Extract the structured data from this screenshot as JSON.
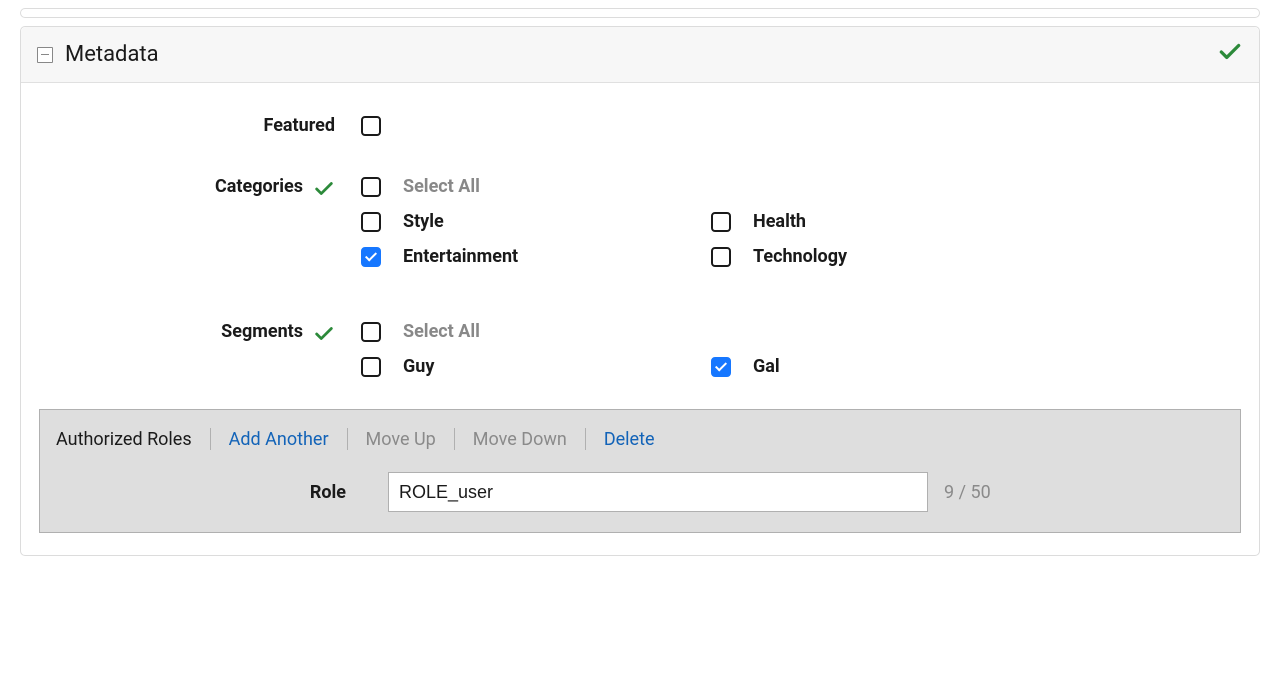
{
  "panel": {
    "title": "Metadata"
  },
  "featured": {
    "label": "Featured",
    "checked": false
  },
  "categories": {
    "label": "Categories",
    "select_all_label": "Select All",
    "select_all_checked": false,
    "options": [
      {
        "label": "Style",
        "checked": false
      },
      {
        "label": "Health",
        "checked": false
      },
      {
        "label": "Entertainment",
        "checked": true
      },
      {
        "label": "Technology",
        "checked": false
      }
    ]
  },
  "segments": {
    "label": "Segments",
    "select_all_label": "Select All",
    "select_all_checked": false,
    "options": [
      {
        "label": "Guy",
        "checked": false
      },
      {
        "label": "Gal",
        "checked": true
      }
    ]
  },
  "roles": {
    "title": "Authorized Roles",
    "add_another": "Add Another",
    "move_up": "Move Up",
    "move_down": "Move Down",
    "delete": "Delete",
    "field_label": "Role",
    "value": "ROLE_user",
    "counter": "9 / 50"
  }
}
